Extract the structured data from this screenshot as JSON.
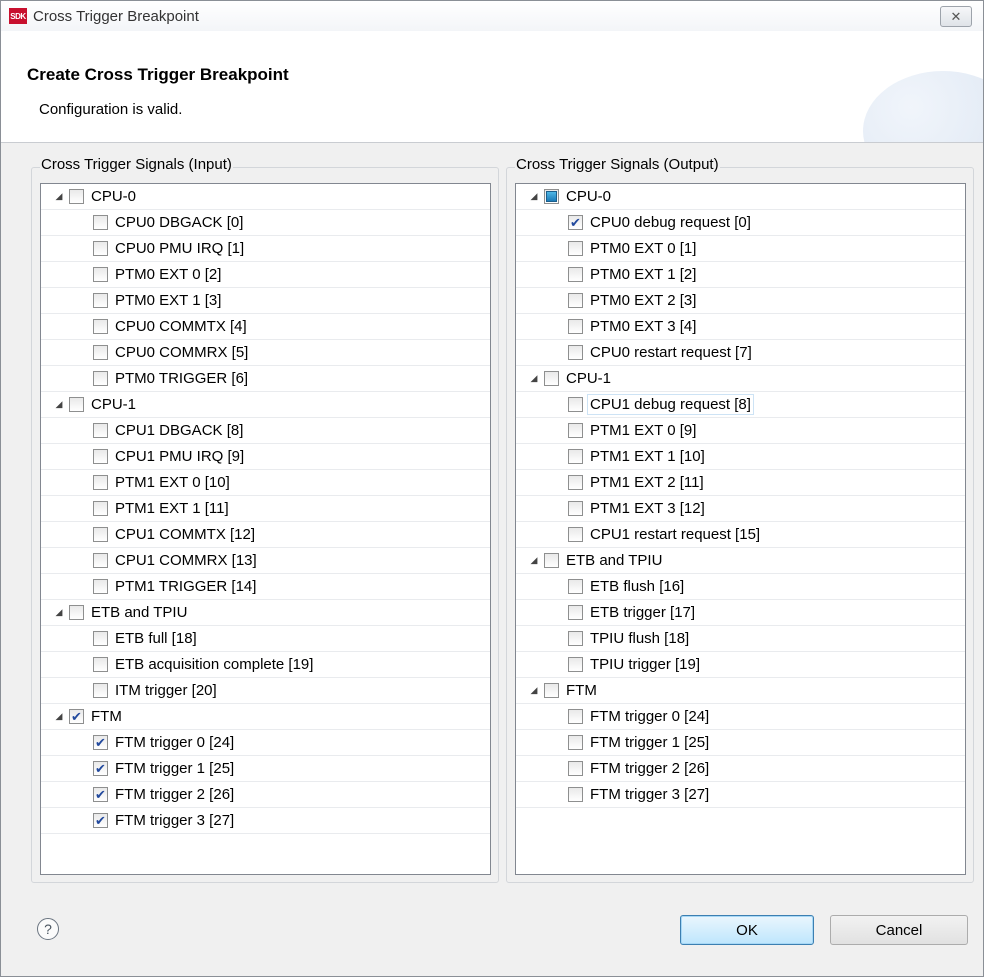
{
  "window": {
    "title": "Cross Trigger Breakpoint",
    "app_icon": "SDK",
    "close_icon": "close-icon"
  },
  "header": {
    "title": "Create Cross Trigger Breakpoint",
    "message": "Configuration is valid."
  },
  "input_panel": {
    "label": "Cross Trigger Signals (Input)",
    "groups": [
      {
        "label": "CPU-0",
        "state": "unchecked",
        "items": [
          {
            "label": "CPU0 DBGACK [0]",
            "checked": false
          },
          {
            "label": "CPU0 PMU IRQ [1]",
            "checked": false
          },
          {
            "label": "PTM0 EXT 0 [2]",
            "checked": false
          },
          {
            "label": "PTM0 EXT 1 [3]",
            "checked": false
          },
          {
            "label": "CPU0 COMMTX [4]",
            "checked": false
          },
          {
            "label": "CPU0 COMMRX [5]",
            "checked": false
          },
          {
            "label": "PTM0 TRIGGER [6]",
            "checked": false
          }
        ]
      },
      {
        "label": "CPU-1",
        "state": "unchecked",
        "items": [
          {
            "label": "CPU1 DBGACK [8]",
            "checked": false
          },
          {
            "label": "CPU1 PMU IRQ [9]",
            "checked": false
          },
          {
            "label": "PTM1 EXT 0 [10]",
            "checked": false
          },
          {
            "label": "PTM1 EXT 1 [11]",
            "checked": false
          },
          {
            "label": "CPU1 COMMTX [12]",
            "checked": false
          },
          {
            "label": "CPU1 COMMRX [13]",
            "checked": false
          },
          {
            "label": "PTM1 TRIGGER [14]",
            "checked": false
          }
        ]
      },
      {
        "label": "ETB and TPIU",
        "state": "unchecked",
        "items": [
          {
            "label": "ETB full [18]",
            "checked": false
          },
          {
            "label": "ETB acquisition complete [19]",
            "checked": false
          },
          {
            "label": "ITM trigger [20]",
            "checked": false
          }
        ]
      },
      {
        "label": "FTM",
        "state": "checked",
        "items": [
          {
            "label": "FTM trigger 0 [24]",
            "checked": true
          },
          {
            "label": "FTM trigger 1 [25]",
            "checked": true
          },
          {
            "label": "FTM trigger 2 [26]",
            "checked": true
          },
          {
            "label": "FTM trigger 3 [27]",
            "checked": true
          }
        ]
      }
    ]
  },
  "output_panel": {
    "label": "Cross Trigger Signals (Output)",
    "groups": [
      {
        "label": "CPU-0",
        "state": "partial",
        "items": [
          {
            "label": "CPU0 debug request [0]",
            "checked": true
          },
          {
            "label": "PTM0 EXT 0 [1]",
            "checked": false
          },
          {
            "label": "PTM0 EXT 1 [2]",
            "checked": false
          },
          {
            "label": "PTM0 EXT 2 [3]",
            "checked": false
          },
          {
            "label": "PTM0 EXT 3 [4]",
            "checked": false
          },
          {
            "label": "CPU0 restart request [7]",
            "checked": false
          }
        ]
      },
      {
        "label": "CPU-1",
        "state": "unchecked",
        "items": [
          {
            "label": "CPU1 debug request [8]",
            "checked": false,
            "focused": true
          },
          {
            "label": "PTM1 EXT 0 [9]",
            "checked": false
          },
          {
            "label": "PTM1 EXT 1 [10]",
            "checked": false
          },
          {
            "label": "PTM1 EXT 2 [11]",
            "checked": false
          },
          {
            "label": "PTM1 EXT 3 [12]",
            "checked": false
          },
          {
            "label": "CPU1 restart request [15]",
            "checked": false
          }
        ]
      },
      {
        "label": "ETB and TPIU",
        "state": "unchecked",
        "items": [
          {
            "label": "ETB flush [16]",
            "checked": false
          },
          {
            "label": "ETB trigger [17]",
            "checked": false
          },
          {
            "label": "TPIU flush [18]",
            "checked": false
          },
          {
            "label": "TPIU trigger [19]",
            "checked": false
          }
        ]
      },
      {
        "label": "FTM",
        "state": "unchecked",
        "items": [
          {
            "label": "FTM trigger 0 [24]",
            "checked": false
          },
          {
            "label": "FTM trigger 1 [25]",
            "checked": false
          },
          {
            "label": "FTM trigger 2 [26]",
            "checked": false
          },
          {
            "label": "FTM trigger 3 [27]",
            "checked": false
          }
        ]
      }
    ]
  },
  "footer": {
    "help_glyph": "?",
    "ok_label": "OK",
    "cancel_label": "Cancel"
  }
}
